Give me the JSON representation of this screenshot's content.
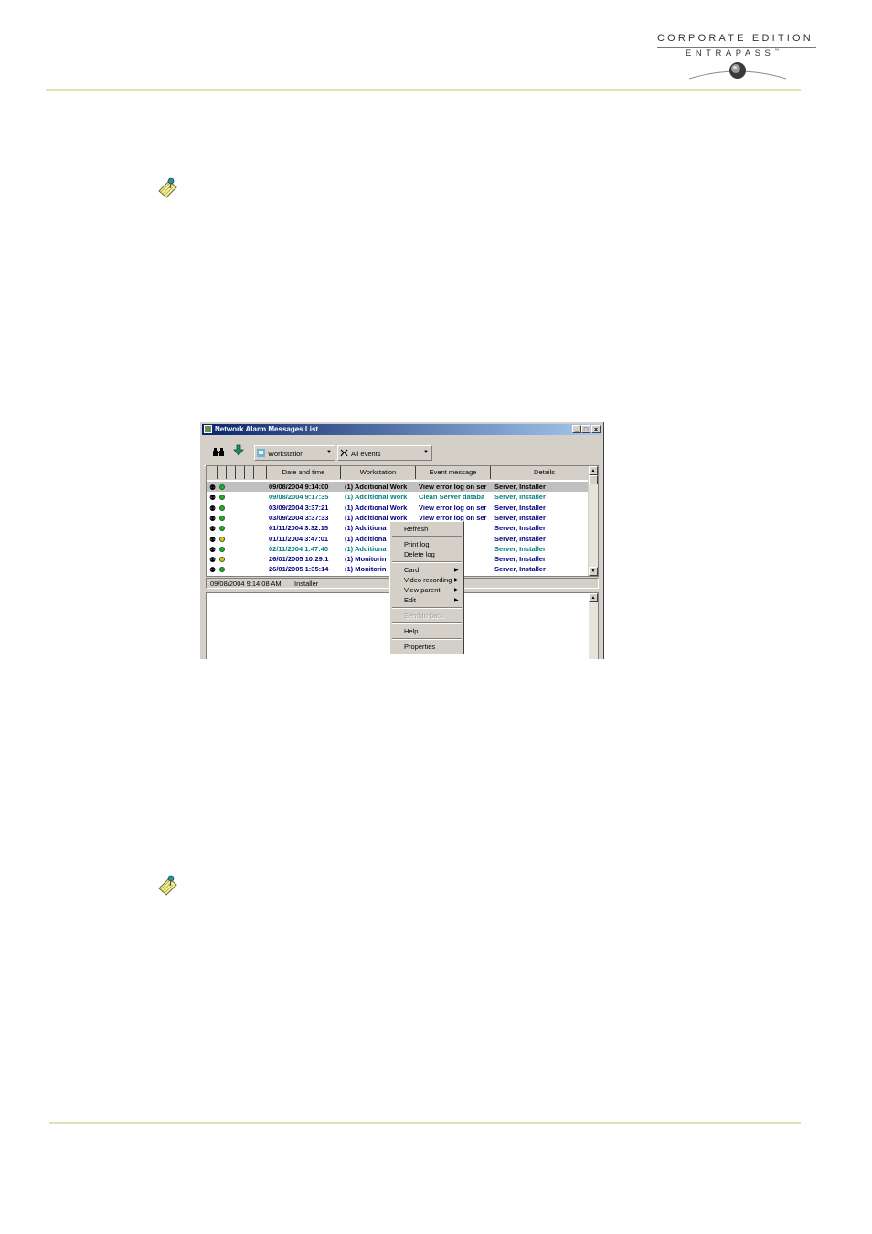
{
  "header": {
    "logo_line1": "CORPORATE EDITION",
    "logo_line2": "ENTRAPASS",
    "logo_tm": "™"
  },
  "icons": {
    "note_icon": "note-pad-icon",
    "colors": {
      "rule": "#dfe0b4",
      "title_bar": "#0a246a",
      "text_dark_blue": "#000080",
      "text_teal": "#008080"
    }
  },
  "window": {
    "title": "Network Alarm Messages List",
    "min_btn": "_",
    "max_btn": "□",
    "close_btn": "×",
    "toolbar": {
      "find_icon": "⚉",
      "workstation_dropdown": "Workstation",
      "events_dropdown": "All events"
    },
    "columns": [
      "Date and time",
      "Workstation",
      "Event message",
      "Details"
    ],
    "rows": [
      {
        "date": "09/08/2004 9:14:00",
        "ws": "(1)  Additional Work",
        "msg": "View error log on ser",
        "details": "Server, Installer",
        "dot": "green",
        "color": "#000000",
        "selected": true
      },
      {
        "date": "09/08/2004 9:17:35",
        "ws": "(1)  Additional Work",
        "msg": "Clean Server databa",
        "details": "Server, Installer",
        "dot": "green",
        "color": "#008080",
        "selected": false
      },
      {
        "date": "03/09/2004 3:37:21",
        "ws": "(1)  Additional Work",
        "msg": "View error log on ser",
        "details": "Server, Installer",
        "dot": "green",
        "color": "#000080",
        "selected": false
      },
      {
        "date": "03/09/2004 3:37:33",
        "ws": "(1)  Additional Work",
        "msg": "View error log on ser",
        "details": "Server, Installer",
        "dot": "green",
        "color": "#000080",
        "selected": false
      },
      {
        "date": "01/11/2004 3:32:15",
        "ws": "(1)  Additiona",
        "msg": "r log on ser",
        "details": "Server, Installer",
        "dot": "green",
        "color": "#000080",
        "selected": false
      },
      {
        "date": "01/11/2004 3:47:01",
        "ws": "(1)  Additiona",
        "msg": "r log on ser",
        "details": "Server, Installer",
        "dot": "yellow",
        "color": "#000080",
        "selected": false
      },
      {
        "date": "02/11/2004 1:47:40",
        "ws": "(1)  Additiona",
        "msg": "er databa",
        "details": "Server, Installer",
        "dot": "green",
        "color": "#008080",
        "selected": false
      },
      {
        "date": "26/01/2005 10:29:1",
        "ws": "(1)  Monitorin",
        "msg": "r log on ser",
        "details": "Server, Installer",
        "dot": "yellow",
        "color": "#000080",
        "selected": false
      },
      {
        "date": "26/01/2005 1:35:14",
        "ws": "(1)  Monitorin",
        "msg": "r log on ser",
        "details": "Server, Installer",
        "dot": "green",
        "color": "#000080",
        "selected": false
      }
    ],
    "status": {
      "datetime": "09/08/2004 9:14:08 AM",
      "user": "Installer"
    },
    "context_menu": {
      "refresh": "Refresh",
      "print_log": "Print log",
      "delete_log": "Delete log",
      "card": "Card",
      "video_recording": "Video recording",
      "view_parent": "View parent",
      "edit": "Edit",
      "send_to_back": "Send to back",
      "help": "Help",
      "properties": "Properties"
    }
  }
}
